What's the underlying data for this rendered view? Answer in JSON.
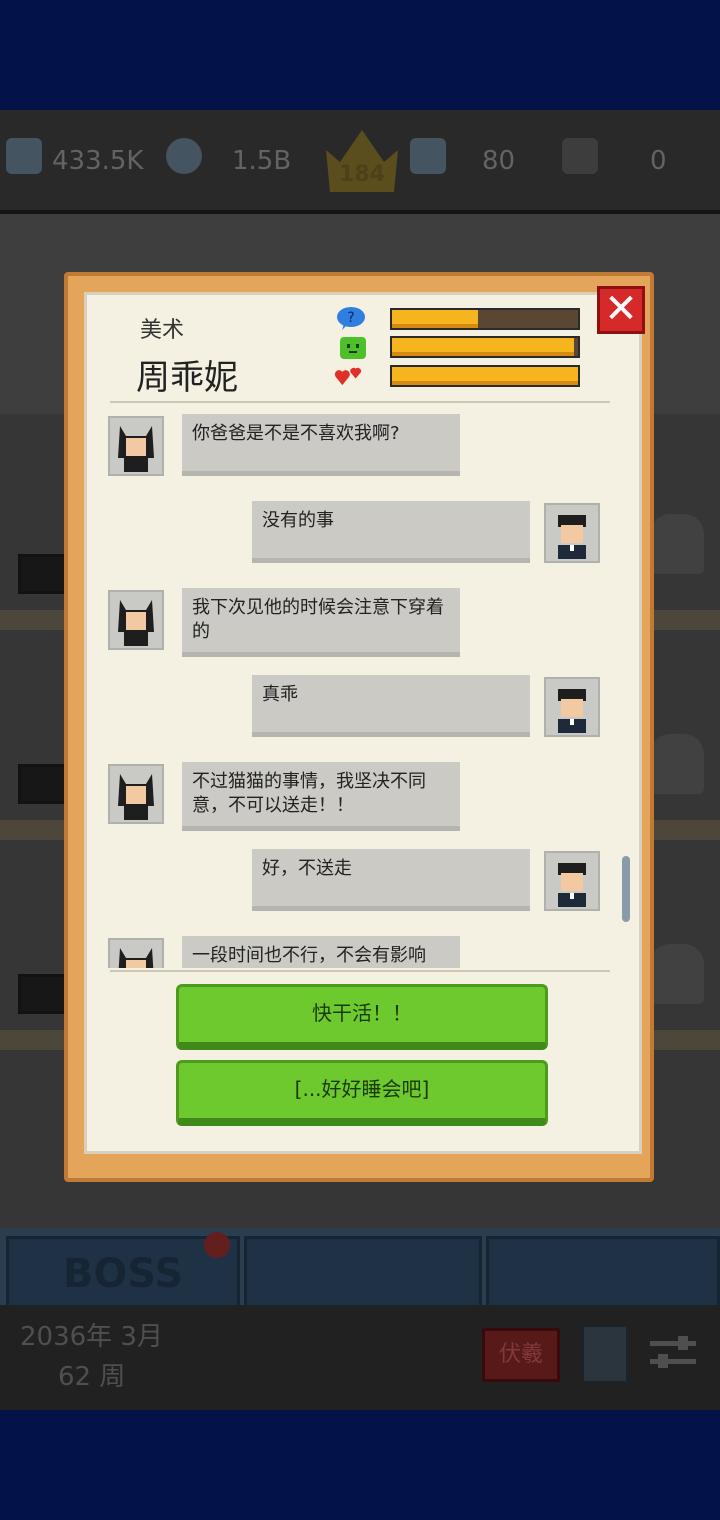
{
  "topbar": {
    "fans": "433.5K",
    "money": "1.5B",
    "crown_level": "184",
    "employees": "80",
    "x_count": "0"
  },
  "dialog": {
    "role": "美术",
    "name": "周乖妮",
    "bars": [
      {
        "icon": "question-bubble-icon",
        "level": 0.46
      },
      {
        "icon": "green-face-icon",
        "level": 0.98
      },
      {
        "icon": "hearts-icon",
        "level": 1.0
      }
    ],
    "messages": [
      {
        "side": "left",
        "text": "你爸爸是不是不喜欢我啊?"
      },
      {
        "side": "right",
        "text": "没有的事"
      },
      {
        "side": "left",
        "text": "我下次见他的时候会注意下穿着的"
      },
      {
        "side": "right",
        "text": "真乖"
      },
      {
        "side": "left",
        "text": "不过猫猫的事情，我坚决不同意，不可以送走！！"
      },
      {
        "side": "right",
        "text": "好，不送走"
      },
      {
        "side": "left",
        "text": "一段时间也不行，不会有影响的，你看多可爱啊"
      }
    ],
    "actions": [
      "快干活！！",
      "[...好好睡会吧]"
    ]
  },
  "bottom": {
    "tabs": [
      "BOSS",
      "",
      ""
    ],
    "date_line1": "2036年 3月",
    "date_line2": "62 周",
    "red_button": "伏羲"
  },
  "colors": {
    "background": "#031248",
    "dialog_frame": "#e4a55a",
    "paper": "#f4f0e2",
    "bar_fill": "#f6b41e",
    "action_green": "#6ec92f",
    "close_red": "#d62a2a"
  }
}
